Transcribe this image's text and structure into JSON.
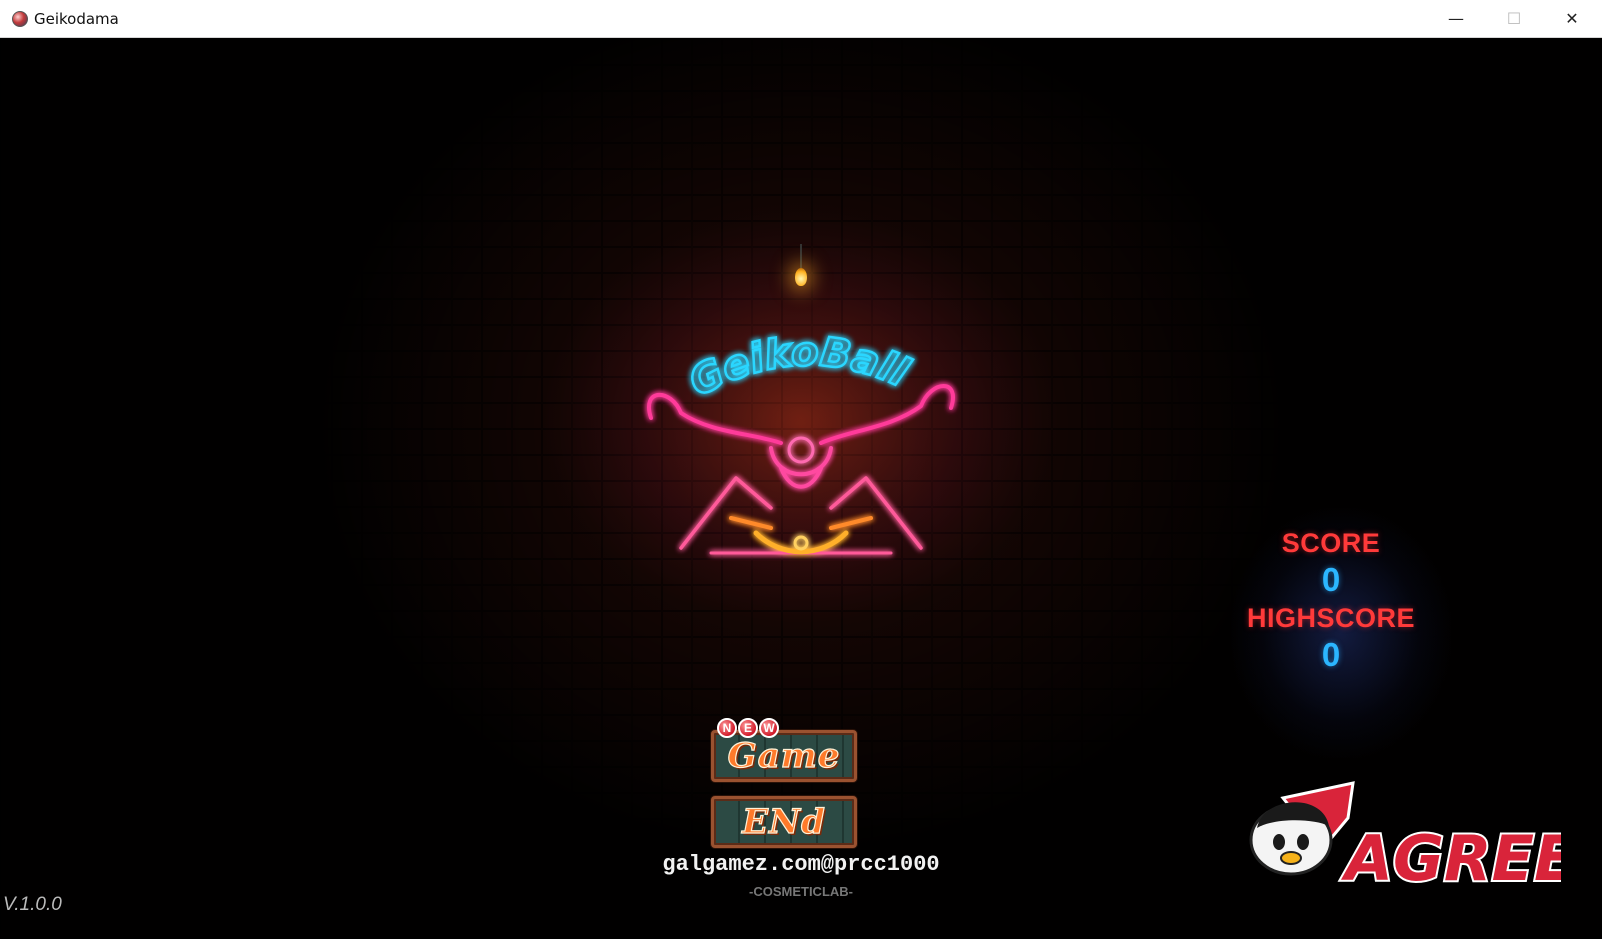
{
  "window": {
    "title": "Geikodama",
    "minimize_glyph": "—",
    "maximize_glyph": "☐",
    "close_glyph": "✕"
  },
  "logo": {
    "text": "GeikoBall",
    "colors": {
      "text": "#2ad6ff",
      "body": "#ff3a9a",
      "accent": "#ff8a2a"
    }
  },
  "score": {
    "score_label": "SCORE",
    "score_value": "0",
    "highscore_label": "HIGHSCORE",
    "highscore_value": "0"
  },
  "menu": {
    "new_badge": [
      "N",
      "E",
      "W"
    ],
    "new_game_label": "Game",
    "end_label": "ENd"
  },
  "credit": "galgamez.com@prcc1000",
  "sublabel": "-COSMETICLAB-",
  "version": "V.1.0.0",
  "brand": "AGREE",
  "colors": {
    "score_label": "#ff3a3a",
    "score_value": "#2bb6ff",
    "button_text": "#ff7a2a"
  }
}
